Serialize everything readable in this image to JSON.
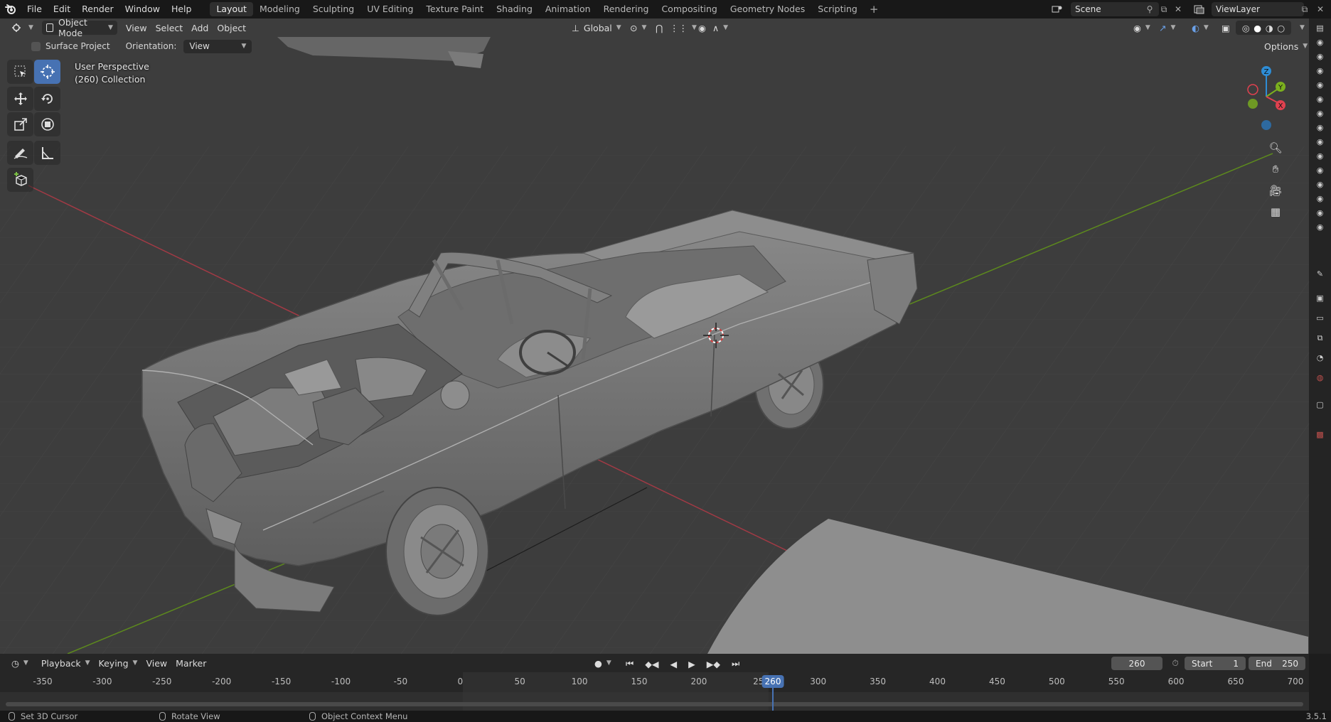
{
  "topbar": {
    "menu": [
      "File",
      "Edit",
      "Render",
      "Window",
      "Help"
    ],
    "workspaces": [
      "Layout",
      "Modeling",
      "Sculpting",
      "UV Editing",
      "Texture Paint",
      "Shading",
      "Animation",
      "Rendering",
      "Compositing",
      "Geometry Nodes",
      "Scripting"
    ],
    "active_workspace": "Layout",
    "add_tab": "+",
    "scene": "Scene",
    "view_layer": "ViewLayer"
  },
  "viewport_header": {
    "mode": "Object Mode",
    "menus": [
      "View",
      "Select",
      "Add",
      "Object"
    ],
    "transform_orientation": "Global",
    "options_label": "Options"
  },
  "tool_settings": {
    "surface_project_label": "Surface Project",
    "orientation_label": "Orientation:",
    "orientation_value": "View"
  },
  "viewport_overlay": {
    "view_name": "User Perspective",
    "collection": "(260) Collection"
  },
  "gizmo": {
    "axes": [
      "Z",
      "Y",
      "X"
    ]
  },
  "timeline": {
    "menus": [
      "Playback",
      "Keying",
      "View",
      "Marker"
    ],
    "current_frame": "260",
    "start_label": "Start",
    "start_value": "1",
    "end_label": "End",
    "end_value": "250",
    "ruler_ticks": [
      "-350",
      "-300",
      "-250",
      "-200",
      "-150",
      "-100",
      "-50",
      "0",
      "50",
      "100",
      "150",
      "200",
      "25",
      "300",
      "350",
      "400",
      "450",
      "500",
      "550",
      "600",
      "650",
      "700"
    ],
    "playhead_label": "260"
  },
  "statusbar": {
    "left": "Set 3D Cursor",
    "middle": "Rotate View",
    "right": "Object Context Menu",
    "version": "3.5.1"
  },
  "colors": {
    "accent": "#4772b3",
    "axis_x": "#e0414f",
    "axis_y": "#7bb01e",
    "axis_z": "#2e8dd6"
  }
}
